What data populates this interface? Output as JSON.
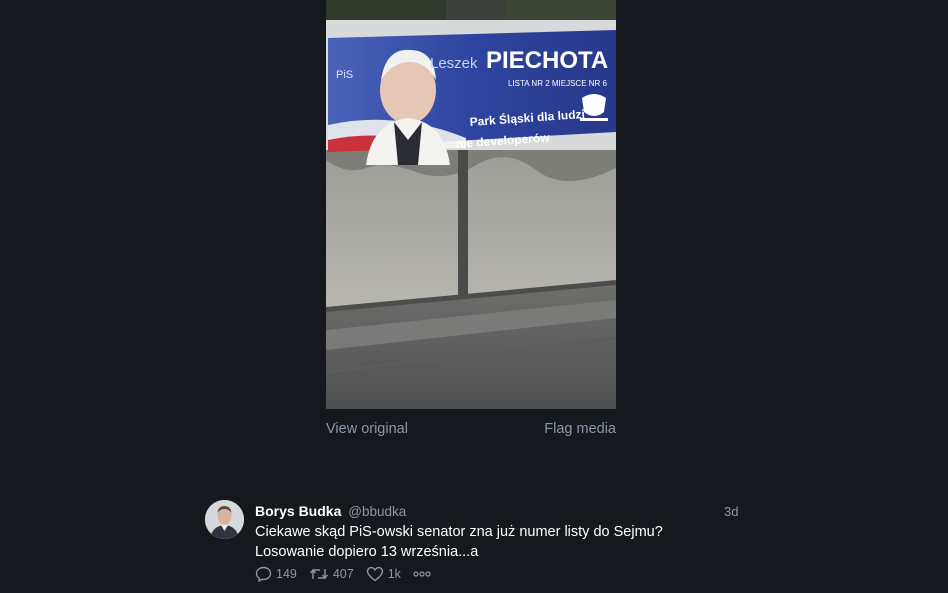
{
  "media": {
    "photo_description_icon": "campaign-billboard-photo",
    "billboard_lettering": {
      "party": "PiS",
      "first_name": "Leszek",
      "last_name": "PIECHOTA",
      "list_line": "LISTA NR 2 MIEJSCE NR 6",
      "slogan_line1": "Park Śląski dla ludzi",
      "slogan_line2": "nie developerów"
    },
    "view_original_label": "View original",
    "flag_media_label": "Flag media"
  },
  "tweet": {
    "display_name": "Borys Budka",
    "handle": "@bbudka",
    "timestamp": "3d",
    "text_line1": "Ciekawe skąd PiS-owski senator zna już numer listy do Sejmu?",
    "text_line2": "Losowanie dopiero 13 września...a",
    "reply_count": "149",
    "retweet_count": "407",
    "like_count": "1k",
    "icons": {
      "reply": "reply-icon",
      "retweet": "retweet-icon",
      "like": "heart-icon",
      "more": "more-dots-icon"
    }
  },
  "colors": {
    "background": "#15181c",
    "secondary_text": "#8b98a5",
    "billboard_blue": "#2f3f8f"
  }
}
